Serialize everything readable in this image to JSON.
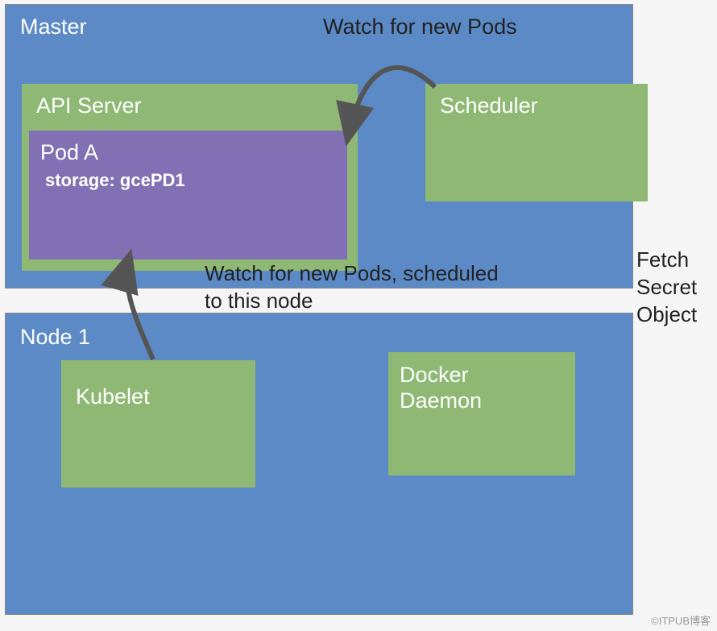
{
  "master": {
    "title": "Master",
    "watch_new_pods": "Watch for new Pods",
    "api_server": {
      "title": "API Server",
      "pod": {
        "title": "Pod A",
        "storage": "storage: gcePD1"
      }
    },
    "scheduler": {
      "title": "Scheduler"
    }
  },
  "annotations": {
    "watch_scheduled": "Watch for new Pods, scheduled to this node",
    "fetch_secret": "Fetch Secret Object"
  },
  "node1": {
    "title": "Node 1",
    "kubelet": {
      "title": "Kubelet"
    },
    "docker_daemon": {
      "title": "Docker Daemon"
    }
  },
  "watermark": "©ITPUB博客"
}
